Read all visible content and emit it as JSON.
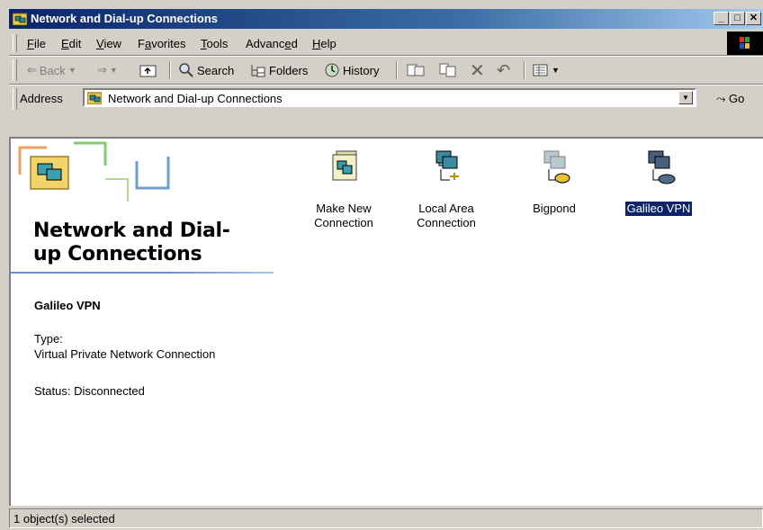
{
  "window": {
    "title": "Network and Dial-up Connections",
    "controls": [
      "minimize",
      "maximize",
      "close"
    ]
  },
  "menu": {
    "file": "File",
    "edit": "Edit",
    "view": "View",
    "favorites": "Favorites",
    "tools": "Tools",
    "advanced": "Advanced",
    "help": "Help"
  },
  "toolbar": {
    "back": "Back",
    "search": "Search",
    "folders": "Folders",
    "history": "History"
  },
  "address": {
    "label": "Address",
    "value": "Network and Dial-up Connections",
    "go": "Go"
  },
  "panel": {
    "title_line1": "Network and Dial-",
    "title_line2": "up Connections",
    "selected_name": "Galileo VPN",
    "type_label": "Type:",
    "type_value": "Virtual Private Network Connection",
    "status": "Status: Disconnected"
  },
  "icons": [
    {
      "line1": "Make New",
      "line2": "Connection",
      "icon": "make-new-connection-icon"
    },
    {
      "line1": "Local Area",
      "line2": "Connection",
      "icon": "lan-connection-icon"
    },
    {
      "line1": "Bigpond",
      "line2": "",
      "icon": "dialup-connection-icon"
    },
    {
      "line1": "Galileo VPN",
      "line2": "",
      "icon": "vpn-connection-icon",
      "selected": true
    }
  ],
  "statusbar": {
    "text": "1 object(s) selected"
  }
}
